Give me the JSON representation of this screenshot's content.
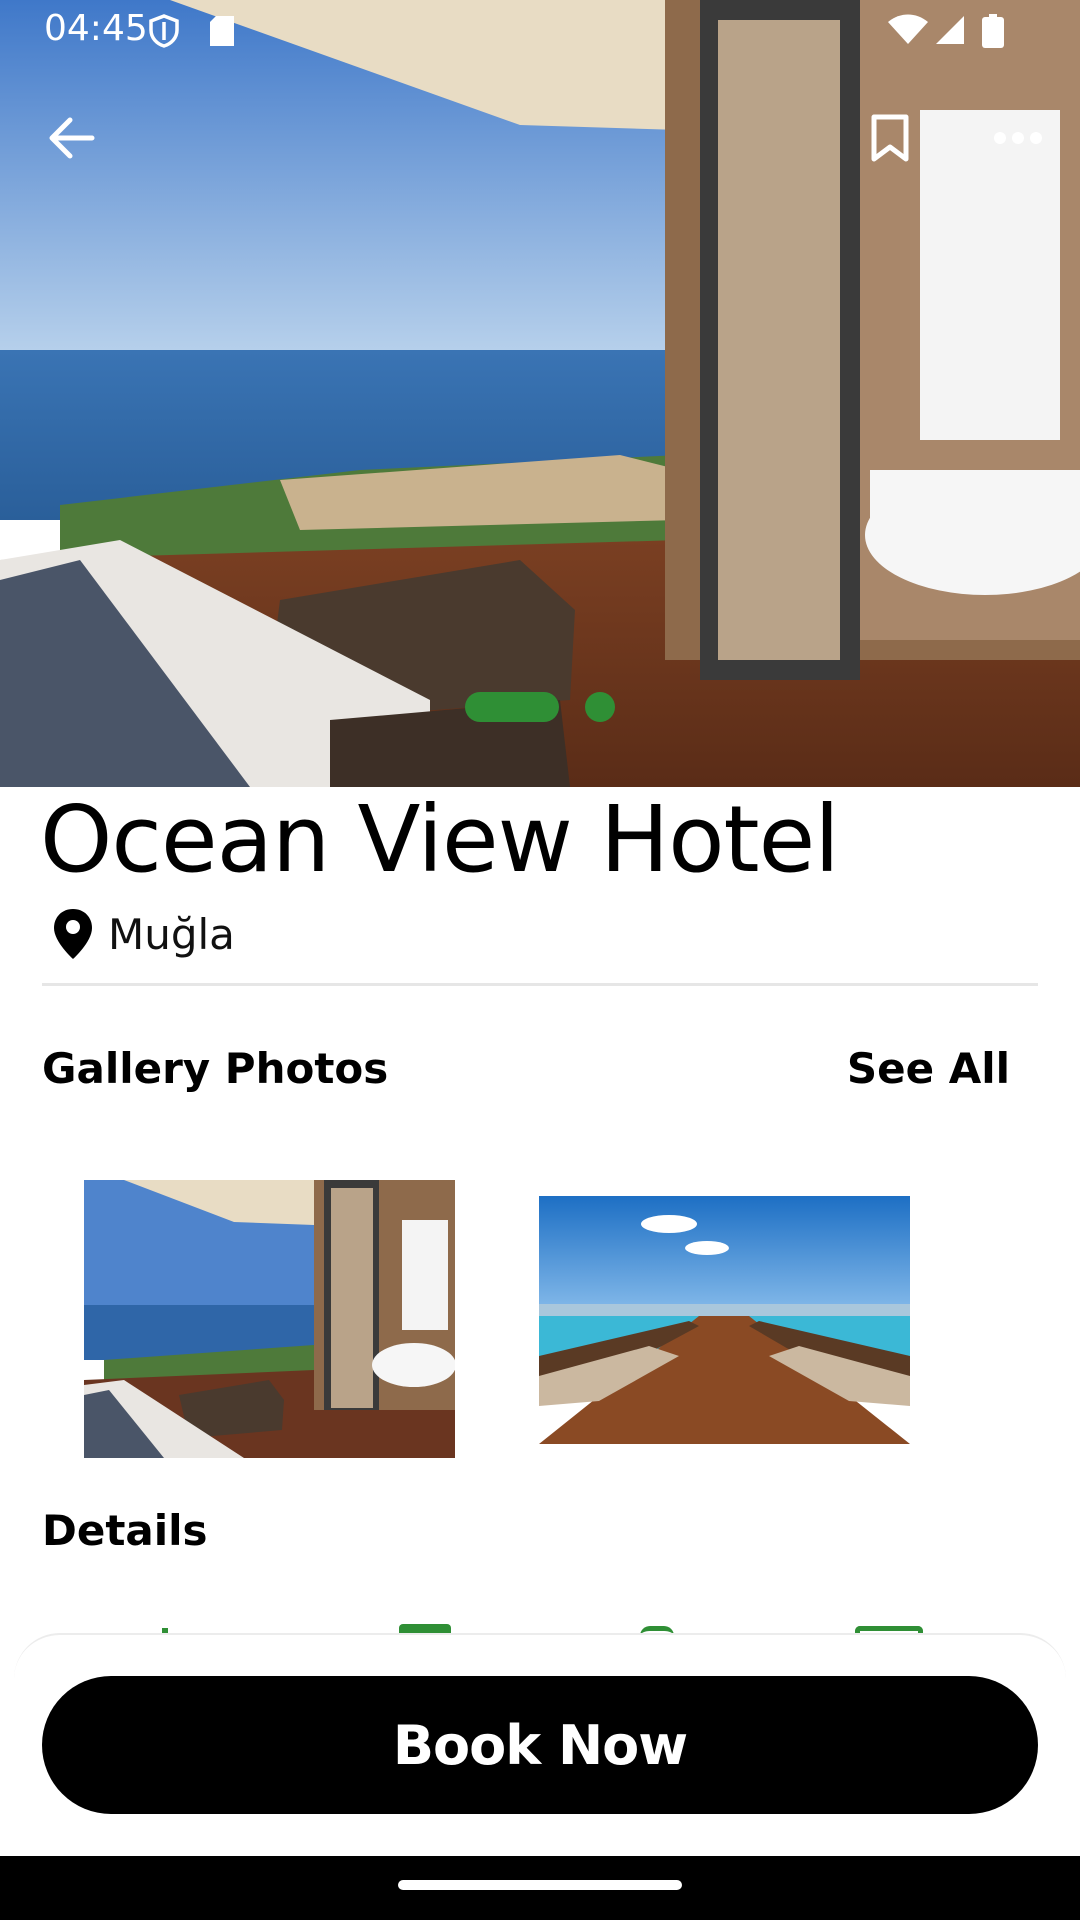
{
  "status_bar": {
    "time": "04:45"
  },
  "hotel": {
    "name": "Ocean View Hotel",
    "location": "Muğla"
  },
  "gallery": {
    "heading": "Gallery Photos",
    "see_all": "See All"
  },
  "details": {
    "heading": "Details"
  },
  "cta": {
    "book_label": "Book Now"
  },
  "carousel": {
    "total": 2,
    "active_index": 0
  },
  "colors": {
    "accent": "#2f8f35",
    "button": "#000000"
  }
}
